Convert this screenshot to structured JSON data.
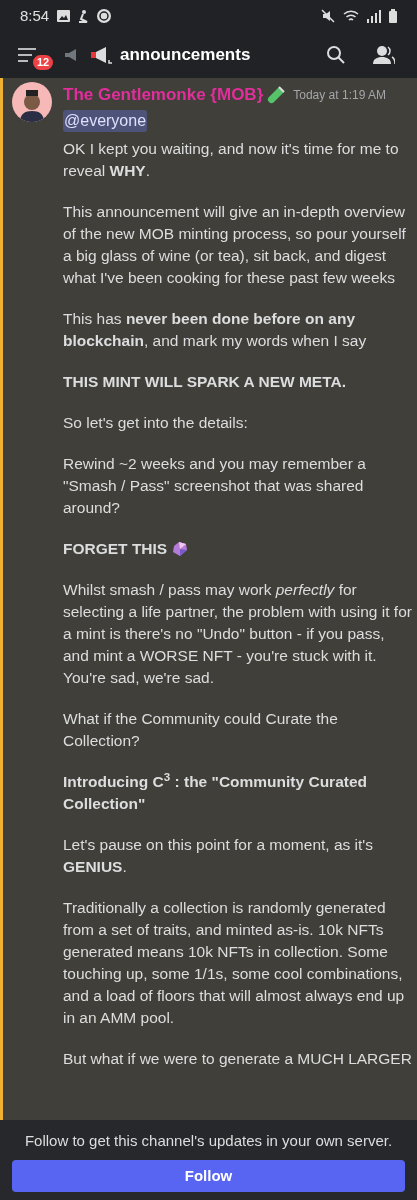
{
  "status_bar": {
    "time": "8:54"
  },
  "header": {
    "badge": "12",
    "channel": "announcements"
  },
  "message": {
    "author": "The Gentlemonke {MOB}",
    "timestamp": "Today at 1:19 AM",
    "mention": "@everyone",
    "paragraphs": [
      {
        "kind": "text",
        "bold": false,
        "text": "OK I kept you waiting, and now it's time for me to reveal **WHY**."
      },
      {
        "kind": "text",
        "bold": false,
        "text": "This announcement will give an in-depth overview of the new MOB minting process, so pour yourself a big glass of wine (or tea), sit back, and digest what I've been cooking for these past few weeks"
      },
      {
        "kind": "text",
        "bold": false,
        "text": "This has **never been done before on any blockchain**, and mark my words when I say"
      },
      {
        "kind": "text",
        "bold": true,
        "text": "THIS MINT WILL SPARK A NEW META."
      },
      {
        "kind": "text",
        "bold": false,
        "text": "So let's get into the details:"
      },
      {
        "kind": "text",
        "bold": false,
        "text": "Rewind ~2 weeks and you may remember a \"Smash / Pass\" screenshot that was shared around?"
      },
      {
        "kind": "emoji",
        "bold": true,
        "text": "FORGET THIS"
      },
      {
        "kind": "text",
        "bold": false,
        "text": "Whilst smash / pass may work *perfectly* for selecting a life partner, the problem with using it for a mint is there's no \"Undo\" button - if you pass, and mint a WORSE NFT - you're stuck with it. You're sad, we're sad."
      },
      {
        "kind": "text",
        "bold": false,
        "text": "What if the Community could Curate the Collection?"
      },
      {
        "kind": "text",
        "bold": true,
        "text": "Introducing C$^{3}$ : the \"Community Curated Collection\""
      },
      {
        "kind": "text",
        "bold": false,
        "text": "Let's pause on this point for a moment, as it's **GENIUS**."
      },
      {
        "kind": "text",
        "bold": false,
        "text": "Traditionally a collection is randomly generated from a set of traits, and minted as-is. 10k NFTs generated means 10k NFTs in collection. Some touching up, some 1/1s, some cool combinations, and a load of floors that will almost always end up in an AMM pool."
      },
      {
        "kind": "text",
        "bold": false,
        "text": "But what if we were to generate a MUCH LARGER"
      }
    ]
  },
  "follow_bar": {
    "text": "Follow to get this channel's updates in your own server.",
    "button": "Follow"
  }
}
